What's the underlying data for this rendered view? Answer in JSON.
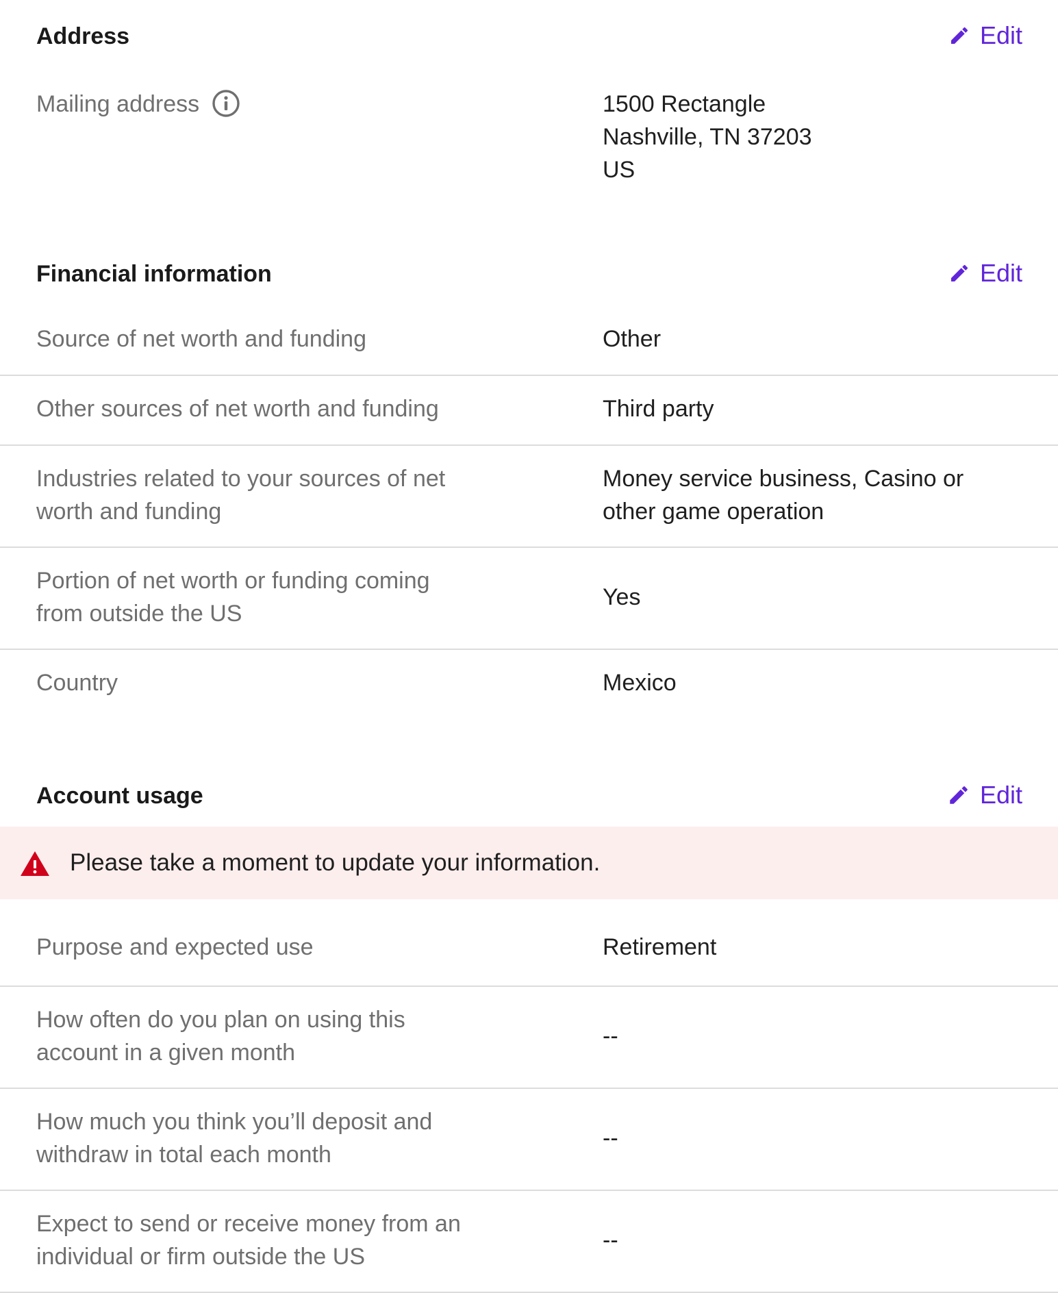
{
  "address": {
    "title": "Address",
    "edit_label": "Edit",
    "mailing_label": "Mailing address",
    "mailing_lines": [
      "1500 Rectangle",
      "Nashville, TN 37203",
      "US"
    ]
  },
  "financial": {
    "title": "Financial information",
    "edit_label": "Edit",
    "rows": [
      {
        "label": "Source of net worth and funding",
        "value": "Other"
      },
      {
        "label": "Other sources of net worth and funding",
        "value": "Third party"
      },
      {
        "label_lines": [
          "Industries related to your sources of net",
          "worth and funding"
        ],
        "value_lines": [
          "Money service business, Casino or",
          "other game operation"
        ]
      },
      {
        "label_lines": [
          "Portion of net worth or funding coming",
          "from outside the US"
        ],
        "value": "Yes"
      },
      {
        "label": "Country",
        "value": "Mexico"
      }
    ]
  },
  "account_usage": {
    "title": "Account usage",
    "edit_label": "Edit",
    "alert_text": "Please take a moment to update your information.",
    "rows": [
      {
        "label": "Purpose and expected use",
        "value": "Retirement"
      },
      {
        "label_lines": [
          "How often do you plan on using this",
          "account in a given month"
        ],
        "value": "--"
      },
      {
        "label_lines": [
          "How much you think you’ll deposit and",
          "withdraw in total each month"
        ],
        "value": "--"
      },
      {
        "label_lines": [
          "Expect to send or receive money from an",
          "individual or firm outside the US"
        ],
        "value": "--"
      }
    ]
  },
  "colors": {
    "accent": "#6025d9",
    "alert_bg": "#fdeeee",
    "alert_icon": "#d0021b",
    "divider": "#dcdcdc",
    "label": "#6f6f6f"
  },
  "icons": {
    "edit": "pencil-icon",
    "info": "info-icon",
    "alert": "warning-triangle-icon"
  }
}
